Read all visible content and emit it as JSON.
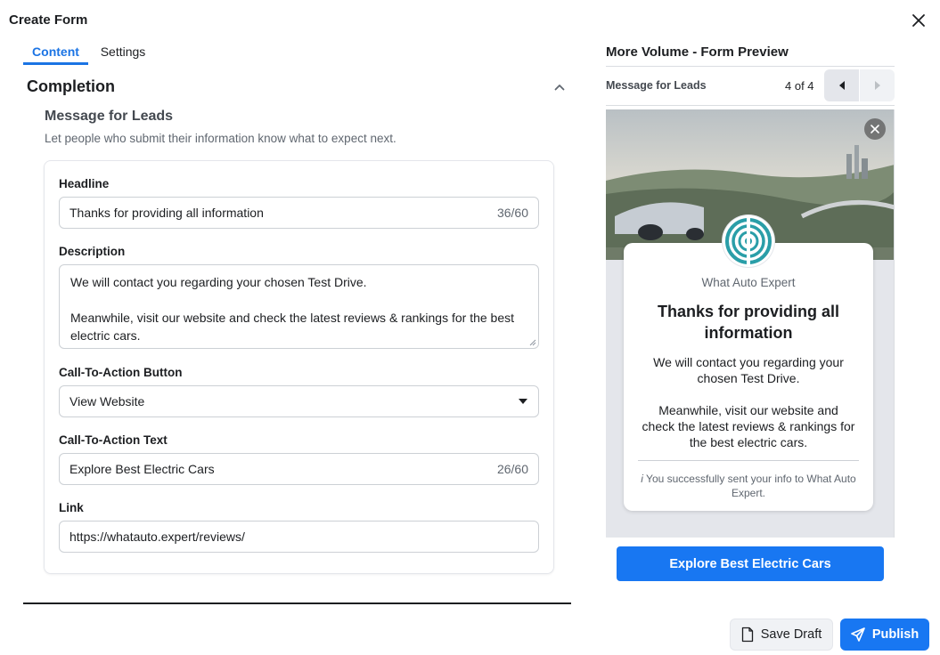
{
  "dialog": {
    "title": "Create Form"
  },
  "tabs": [
    {
      "label": "Content",
      "active": true
    },
    {
      "label": "Settings",
      "active": false
    }
  ],
  "section": {
    "title": "Completion",
    "subtitle": "Message for Leads",
    "description": "Let people who submit their information know what to expect next."
  },
  "fields": {
    "headline": {
      "label": "Headline",
      "value": "Thanks for providing all information",
      "count": "36/60"
    },
    "description": {
      "label": "Description",
      "para1": "We will contact you regarding your chosen Test Drive.",
      "para2": "Meanwhile, visit our website and check the latest reviews & rankings for the best electric cars."
    },
    "cta_button": {
      "label": "Call-To-Action Button",
      "value": "View Website"
    },
    "cta_text": {
      "label": "Call-To-Action Text",
      "value": "Explore Best Electric Cars",
      "count": "26/60"
    },
    "link": {
      "label": "Link",
      "value": "https://whatauto.expert/reviews/"
    }
  },
  "preview": {
    "title": "More Volume - Form Preview",
    "screen_label": "Message for Leads",
    "page_counter": "4 of 4",
    "brand": "What Auto Expert",
    "headline": "Thanks for providing all information",
    "body1": "We will contact you regarding your chosen Test Drive.",
    "body2": "Meanwhile, visit our website and check the latest reviews & rankings for the best electric cars.",
    "note_icon": "i",
    "note": "You successfully sent your info to What Auto Expert.",
    "cta": "Explore Best Electric Cars"
  },
  "footer": {
    "save_draft": "Save Draft",
    "publish": "Publish"
  },
  "colors": {
    "accent": "#1877f2",
    "tab_active": "#1b74e4"
  },
  "icons": {
    "close": "close-icon",
    "collapse": "chevron-up-icon",
    "dropdown": "caret-down-icon",
    "prev": "caret-left-icon",
    "next": "caret-right-icon",
    "draft": "document-icon",
    "publish": "send-icon"
  }
}
